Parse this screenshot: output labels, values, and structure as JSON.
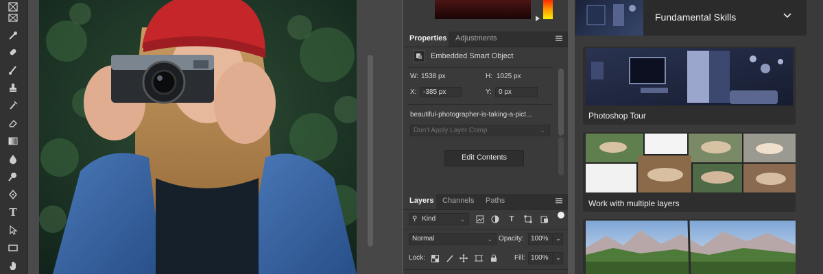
{
  "toolbar": {
    "tools": [
      "frame-tool",
      "eyedropper-tool",
      "healing-brush-tool",
      "brush-tool",
      "clone-stamp-tool",
      "history-brush-tool",
      "eraser-tool",
      "gradient-tool",
      "blur-tool",
      "dodge-tool",
      "pen-tool",
      "type-tool",
      "path-selection-tool",
      "rectangle-tool",
      "hand-tool"
    ],
    "type_glyph": "T"
  },
  "properties": {
    "tab_properties": "Properties",
    "tab_adjustments": "Adjustments",
    "object_type": "Embedded Smart Object",
    "w_label": "W:",
    "w_value": "1538 px",
    "h_label": "H:",
    "h_value": "1025 px",
    "x_label": "X:",
    "x_value": "-385 px",
    "y_label": "Y:",
    "y_value": "0 px",
    "filename": "beautiful-photographer-is-taking-a-pict...",
    "layer_comp_placeholder": "Don't Apply Layer Comp",
    "edit_contents": "Edit Contents"
  },
  "layers": {
    "tab_layers": "Layers",
    "tab_channels": "Channels",
    "tab_paths": "Paths",
    "filter_kind": "Kind",
    "blend_mode": "Normal",
    "opacity_label": "Opacity:",
    "opacity_value": "100%",
    "lock_label": "Lock:",
    "fill_label": "Fill:",
    "fill_value": "100%"
  },
  "learn": {
    "section_title": "Fundamental Skills",
    "cards": [
      {
        "title": "Photoshop Tour"
      },
      {
        "title": "Work with multiple layers"
      }
    ]
  },
  "colors": {
    "app_bg": "#535353",
    "panel_bg": "#3a3a3a",
    "accent_red": "#c0282a"
  }
}
